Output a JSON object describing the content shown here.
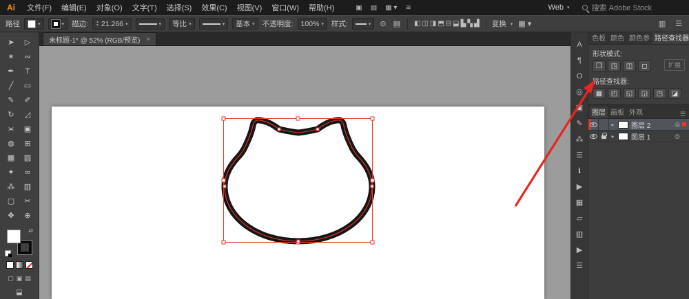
{
  "colors": {
    "selection_red": "#e8372e",
    "arrow_red": "#e8261f",
    "accent_orange": "#f79500"
  },
  "menu_bar": {
    "logo": "Ai",
    "items": [
      "文件(F)",
      "编辑(E)",
      "对象(O)",
      "文字(T)",
      "选择(S)",
      "效果(C)",
      "视图(V)",
      "窗口(W)",
      "帮助(H)"
    ],
    "icons": [
      {
        "name": "arrange-documents-icon",
        "glyph": "▣"
      },
      {
        "name": "document-layout-icon",
        "glyph": "▤"
      },
      {
        "name": "layout-grid-icon",
        "glyph": "▦ ▾"
      },
      {
        "name": "gpu-performance-icon",
        "glyph": "≋"
      }
    ],
    "workspace_label": "Web",
    "search_placeholder": "搜索 Adobe Stock"
  },
  "control_bar": {
    "selection_type": "路径",
    "stroke_label": "描边:",
    "stroke_value": "21.266",
    "profile_value": "等比",
    "brush_value": "基本",
    "opacity_label": "不透明度:",
    "opacity_value": "100%",
    "style_label": "样式:",
    "transform_label": "变换",
    "align_icons": [
      {
        "name": "align-left-icon",
        "glyph": "◧"
      },
      {
        "name": "align-center-horizontal-icon",
        "glyph": "◫"
      },
      {
        "name": "align-right-icon",
        "glyph": "◨"
      },
      {
        "name": "align-top-icon",
        "glyph": "⬒"
      },
      {
        "name": "align-middle-vertical-icon",
        "glyph": "⊟"
      },
      {
        "name": "align-bottom-icon",
        "glyph": "⬓"
      },
      {
        "name": "distribute-left-icon",
        "glyph": "▙"
      },
      {
        "name": "distribute-center-icon",
        "glyph": "▚"
      },
      {
        "name": "distribute-right-icon",
        "glyph": "▟"
      }
    ]
  },
  "document_tab": {
    "title": "未标题-1* @ 52% (RGB/预览)",
    "close_label": "×"
  },
  "tools": [
    {
      "name": "selection-tool-icon",
      "glyph": "➤"
    },
    {
      "name": "direct-selection-tool-icon",
      "glyph": "▷"
    },
    {
      "name": "magic-wand-tool-icon",
      "glyph": "✶"
    },
    {
      "name": "lasso-tool-icon",
      "glyph": "∾"
    },
    {
      "name": "pen-tool-icon",
      "glyph": "✒"
    },
    {
      "name": "type-tool-icon",
      "glyph": "T"
    },
    {
      "name": "line-segment-tool-icon",
      "glyph": "╱"
    },
    {
      "name": "rectangle-tool-icon",
      "glyph": "▭"
    },
    {
      "name": "paintbrush-tool-icon",
      "glyph": "✎"
    },
    {
      "name": "pencil-tool-icon",
      "glyph": "✐"
    },
    {
      "name": "rotate-tool-icon",
      "glyph": "↻"
    },
    {
      "name": "scale-tool-icon",
      "glyph": "◿"
    },
    {
      "name": "width-tool-icon",
      "glyph": "≍"
    },
    {
      "name": "free-transform-tool-icon",
      "glyph": "▣"
    },
    {
      "name": "shape-builder-tool-icon",
      "glyph": "◍"
    },
    {
      "name": "perspective-grid-tool-icon",
      "glyph": "⊞"
    },
    {
      "name": "mesh-tool-icon",
      "glyph": "▦"
    },
    {
      "name": "gradient-tool-icon",
      "glyph": "▨"
    },
    {
      "name": "eyedropper-tool-icon",
      "glyph": "✦"
    },
    {
      "name": "blend-tool-icon",
      "glyph": "∞"
    },
    {
      "name": "symbol-sprayer-tool-icon",
      "glyph": "⁂"
    },
    {
      "name": "column-graph-tool-icon",
      "glyph": "▥"
    },
    {
      "name": "artboard-tool-icon",
      "glyph": "▢"
    },
    {
      "name": "slice-tool-icon",
      "glyph": "✂"
    },
    {
      "name": "hand-tool-icon",
      "glyph": "✥"
    },
    {
      "name": "zoom-tool-icon",
      "glyph": "⊕"
    }
  ],
  "panel_strip_icons": [
    {
      "name": "character-panel-icon",
      "glyph": "A"
    },
    {
      "name": "paragraph-panel-icon",
      "glyph": "¶"
    },
    {
      "name": "opentype-panel-icon",
      "glyph": "O"
    },
    {
      "name": "appearance-panel-icon",
      "glyph": "◎"
    },
    {
      "name": "graphic-styles-panel-icon",
      "glyph": "▣"
    },
    {
      "name": "brushes-panel-icon",
      "glyph": "✎"
    },
    {
      "name": "symbols-panel-icon",
      "glyph": "⁂"
    },
    {
      "name": "stroke-panel-icon",
      "glyph": "☰"
    },
    {
      "name": "info-panel-icon",
      "glyph": "ℹ"
    },
    {
      "name": "actions-panel-icon",
      "glyph": "▶"
    },
    {
      "name": "links-panel-icon",
      "glyph": "▦"
    },
    {
      "name": "transform-panel-icon",
      "glyph": "▱"
    },
    {
      "name": "align-panel-icon",
      "glyph": "▥"
    },
    {
      "name": "navigator-panel-icon",
      "glyph": "▶"
    },
    {
      "name": "panel-options-icon",
      "glyph": "☰"
    }
  ],
  "pathfinder_panel": {
    "tabs": [
      "色板",
      "颜色",
      "颜色参",
      "路径查找器"
    ],
    "shape_modes_label": "形状模式:",
    "shape_mode_buttons": [
      {
        "name": "unite-icon",
        "glyph": "❒"
      },
      {
        "name": "minus-front-icon",
        "glyph": "◳"
      },
      {
        "name": "intersect-icon",
        "glyph": "◫"
      },
      {
        "name": "exclude-icon",
        "glyph": "◻"
      }
    ],
    "expand_label": "扩展",
    "pathfinder_label": "路径查找器:",
    "pathfinder_buttons": [
      {
        "name": "divide-icon",
        "glyph": "▦"
      },
      {
        "name": "trim-icon",
        "glyph": "◰"
      },
      {
        "name": "merge-icon",
        "glyph": "◱"
      },
      {
        "name": "crop-icon",
        "glyph": "◲"
      },
      {
        "name": "outline-icon",
        "glyph": "◳"
      },
      {
        "name": "minus-back-icon",
        "glyph": "◪"
      }
    ]
  },
  "layers_panel": {
    "tabs": [
      "图层",
      "画板",
      "外观"
    ],
    "layers": [
      {
        "name": "图层 2",
        "selected": true,
        "visible": true,
        "locked": false
      },
      {
        "name": "图层 1",
        "selected": false,
        "visible": true,
        "locked": true
      }
    ]
  }
}
